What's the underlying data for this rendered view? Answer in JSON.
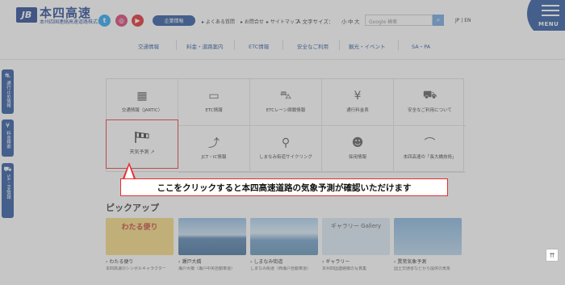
{
  "header": {
    "logo_mark": "JB",
    "logo_title": "本四高速",
    "logo_subtitle": "本州四国連絡高速道路株式会社",
    "sns": {
      "twitter": "t",
      "instagram": "◎",
      "youtube": "▶"
    },
    "corporate_button": "企業情報",
    "util_links": [
      "よくある質問",
      "お問合せ",
      "サイトマップ"
    ],
    "font_size_label": "A 文字サイズ：",
    "font_size_options": [
      "小",
      "中",
      "大"
    ],
    "search_placeholder": "Google 検索",
    "search_icon": "search-icon",
    "lang": "JP | EN",
    "menu_label": "MENU"
  },
  "nav": {
    "items": [
      "交通情報",
      "料金・道路案内",
      "ETC情報",
      "安全なご利用",
      "観光・イベント",
      "SA・PA"
    ]
  },
  "side_tabs": [
    {
      "icon": "road-icon",
      "label": "通行止め情報"
    },
    {
      "icon": "yen-icon",
      "label": "料金検索"
    },
    {
      "icon": "sa-icon",
      "label": "SA・PA情報"
    }
  ],
  "grid": {
    "cells": [
      {
        "icon": "traffic-info-icon",
        "label": "交通情報（JARTIC）"
      },
      {
        "icon": "etc-card-icon",
        "label": "ETC情報"
      },
      {
        "icon": "etc-lane-icon",
        "label": "ETCレーン閉鎖情報"
      },
      {
        "icon": "yen-icon",
        "label": "通行料金表"
      },
      {
        "icon": "safety-icon",
        "label": "安全なご利用について"
      },
      {
        "icon": "weather-icon",
        "label": "天気予測"
      },
      {
        "icon": "junction-icon",
        "label": "JCT・IC情報"
      },
      {
        "icon": "cycling-icon",
        "label": "しまなみ街道サイクリング"
      },
      {
        "icon": "recruit-icon",
        "label": "採用情報"
      },
      {
        "icon": "bridge-icon",
        "label": "本四高速の「長大橋技術」"
      }
    ]
  },
  "callout": "ここをクリックすると本四高速道路の気象予測が確認いただけます",
  "pickup": {
    "title": "ピックアップ",
    "cards": [
      {
        "title": "わたる便り",
        "desc": "本四高速のシンボルキャラクター",
        "img_text": "わたる便り"
      },
      {
        "title": "瀬戸大橋",
        "desc": "瀬戸大橋（瀬戸中央自動車道）",
        "img_text": ""
      },
      {
        "title": "しまなみ街道",
        "desc": "しまなみ街道（西瀬戸自動車道）",
        "img_text": ""
      },
      {
        "title": "ギャラリー",
        "desc": "本州四国連絡橋の写真集",
        "img_text": "ギャラリー Gallery"
      },
      {
        "title": "異常気象予測",
        "desc": "国土交通省などから提供の気象",
        "img_text": ""
      }
    ]
  },
  "totop": "⇈"
}
